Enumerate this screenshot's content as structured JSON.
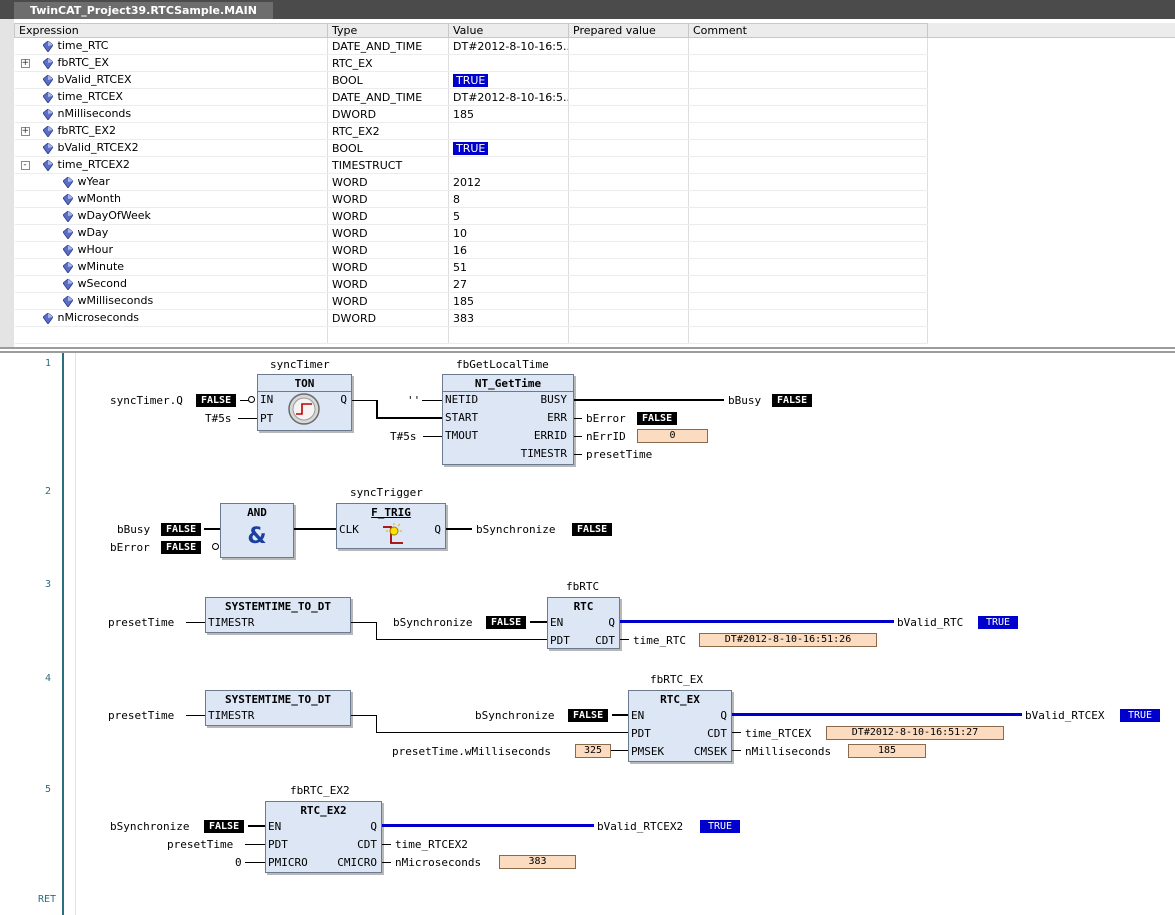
{
  "window": {
    "tab_title": "TwinCAT_Project39.RTCSample.MAIN"
  },
  "watch": {
    "columns": [
      "Expression",
      "Type",
      "Value",
      "Prepared value",
      "Comment"
    ],
    "rows": [
      {
        "expr": "time_RTC",
        "type": "DATE_AND_TIME",
        "value": "DT#2012-8-10-16:5...",
        "level": 0,
        "expander": "",
        "highlight": false
      },
      {
        "expr": "fbRTC_EX",
        "type": "RTC_EX",
        "value": "",
        "level": 0,
        "expander": "+",
        "highlight": false
      },
      {
        "expr": "bValid_RTCEX",
        "type": "BOOL",
        "value": "TRUE",
        "level": 0,
        "expander": "",
        "highlight": true
      },
      {
        "expr": "time_RTCEX",
        "type": "DATE_AND_TIME",
        "value": "DT#2012-8-10-16:5...",
        "level": 0,
        "expander": "",
        "highlight": false
      },
      {
        "expr": "nMilliseconds",
        "type": "DWORD",
        "value": "185",
        "level": 0,
        "expander": "",
        "highlight": false
      },
      {
        "expr": "fbRTC_EX2",
        "type": "RTC_EX2",
        "value": "",
        "level": 0,
        "expander": "+",
        "highlight": false
      },
      {
        "expr": "bValid_RTCEX2",
        "type": "BOOL",
        "value": "TRUE",
        "level": 0,
        "expander": "",
        "highlight": true
      },
      {
        "expr": "time_RTCEX2",
        "type": "TIMESTRUCT",
        "value": "",
        "level": 0,
        "expander": "-",
        "highlight": false
      },
      {
        "expr": "wYear",
        "type": "WORD",
        "value": "2012",
        "level": 1,
        "expander": "",
        "highlight": false
      },
      {
        "expr": "wMonth",
        "type": "WORD",
        "value": "8",
        "level": 1,
        "expander": "",
        "highlight": false
      },
      {
        "expr": "wDayOfWeek",
        "type": "WORD",
        "value": "5",
        "level": 1,
        "expander": "",
        "highlight": false
      },
      {
        "expr": "wDay",
        "type": "WORD",
        "value": "10",
        "level": 1,
        "expander": "",
        "highlight": false
      },
      {
        "expr": "wHour",
        "type": "WORD",
        "value": "16",
        "level": 1,
        "expander": "",
        "highlight": false
      },
      {
        "expr": "wMinute",
        "type": "WORD",
        "value": "51",
        "level": 1,
        "expander": "",
        "highlight": false
      },
      {
        "expr": "wSecond",
        "type": "WORD",
        "value": "27",
        "level": 1,
        "expander": "",
        "highlight": false
      },
      {
        "expr": "wMilliseconds",
        "type": "WORD",
        "value": "185",
        "level": 1,
        "expander": "",
        "highlight": false
      },
      {
        "expr": "nMicroseconds",
        "type": "DWORD",
        "value": "383",
        "level": 0,
        "expander": "",
        "highlight": false
      }
    ]
  },
  "fbd": {
    "ret_label": "RET",
    "net1": {
      "num": "1",
      "ton_instance": "syncTimer",
      "ton_type": "TON",
      "ton_in": "IN",
      "ton_pt": "PT",
      "ton_q": "Q",
      "in_var": "syncTimer.Q",
      "in_val": "FALSE",
      "pt_var": "T#5s",
      "nt_instance": "fbGetLocalTime",
      "nt_type": "NT_GetTime",
      "nt_netid": "NETID",
      "nt_start": "START",
      "nt_tmout": "TMOUT",
      "nt_busy": "BUSY",
      "nt_err": "ERR",
      "nt_errid": "ERRID",
      "nt_timestr": "TIMESTR",
      "netid_var": "''",
      "tmout_var": "T#5s",
      "busy_var": "bBusy",
      "busy_val": "FALSE",
      "err_var": "bError",
      "err_val": "FALSE",
      "errid_var": "nErrID",
      "errid_val": "0",
      "timestr_var": "presetTime"
    },
    "net2": {
      "num": "2",
      "and_type": "AND",
      "and_symbol": "&",
      "in1_var": "bBusy",
      "in1_val": "FALSE",
      "in2_var": "bError",
      "in2_val": "FALSE",
      "trig_instance": "syncTrigger",
      "trig_type": "F_TRIG",
      "trig_clk": "CLK",
      "trig_q": "Q",
      "out_var": "bSynchronize",
      "out_val": "FALSE"
    },
    "net3": {
      "num": "3",
      "conv_type": "SYSTEMTIME_TO_DT",
      "conv_in": "TIMESTR",
      "conv_in_var": "presetTime",
      "rtc_instance": "fbRTC",
      "rtc_type": "RTC",
      "rtc_en": "EN",
      "rtc_pdt": "PDT",
      "rtc_q": "Q",
      "rtc_cdt": "CDT",
      "en_var": "bSynchronize",
      "en_val": "FALSE",
      "q_var": "bValid_RTC",
      "q_val": "TRUE",
      "cdt_var": "time_RTC",
      "cdt_val": "DT#2012-8-10-16:51:26"
    },
    "net4": {
      "num": "4",
      "conv_type": "SYSTEMTIME_TO_DT",
      "conv_in": "TIMESTR",
      "conv_in_var": "presetTime",
      "rtc_instance": "fbRTC_EX",
      "rtc_type": "RTC_EX",
      "rtc_en": "EN",
      "rtc_pdt": "PDT",
      "rtc_pmsek": "PMSEK",
      "rtc_q": "Q",
      "rtc_cdt": "CDT",
      "rtc_cmsek": "CMSEK",
      "en_var": "bSynchronize",
      "en_val": "FALSE",
      "pmsek_var": "presetTime.wMilliseconds",
      "pmsek_val": "325",
      "q_var": "bValid_RTCEX",
      "q_val": "TRUE",
      "cdt_var": "time_RTCEX",
      "cdt_val": "DT#2012-8-10-16:51:27",
      "cmsek_var": "nMilliseconds",
      "cmsek_val": "185"
    },
    "net5": {
      "num": "5",
      "rtc_instance": "fbRTC_EX2",
      "rtc_type": "RTC_EX2",
      "rtc_en": "EN",
      "rtc_pdt": "PDT",
      "rtc_pmicro": "PMICRO",
      "rtc_q": "Q",
      "rtc_cdt": "CDT",
      "rtc_cmicro": "CMICRO",
      "en_var": "bSynchronize",
      "en_val": "FALSE",
      "pdt_var": "presetTime",
      "pmicro_var": "0",
      "q_var": "bValid_RTCEX2",
      "q_val": "TRUE",
      "cdt_var": "time_RTCEX2",
      "cmicro_var": "nMicroseconds",
      "cmicro_val": "383"
    }
  },
  "colors": {
    "true_bg": "#0000cc",
    "false_bg": "#000000",
    "value_box": "#fbdcc0",
    "block_fill": "#dde6f5",
    "gutter_accent": "#2a6f7e"
  },
  "icons": {
    "variable": "variable-icon",
    "timer": "clock-icon",
    "trigger": "falling-edge-icon"
  }
}
